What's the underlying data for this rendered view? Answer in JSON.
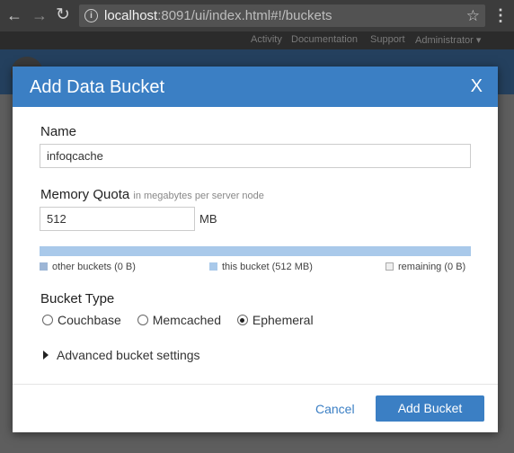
{
  "browser": {
    "url_host": "localhost",
    "url_rest": ":8091/ui/index.html#!/buckets"
  },
  "app_nav": {
    "links": [
      "Activity",
      "Documentation",
      "Support",
      "Administrator ▾"
    ]
  },
  "modal": {
    "title": "Add Data Bucket",
    "close_label": "X",
    "name_label": "Name",
    "name_value": "infoqcache",
    "memory_label": "Memory Quota",
    "memory_hint": "in megabytes per server node",
    "memory_value": "512",
    "memory_unit": "MB",
    "quota_bar": {
      "legend": [
        {
          "label": "other buckets (0 B)",
          "color": "#9db6d6"
        },
        {
          "label": "this bucket (512 MB)",
          "color": "#a9c9ea"
        },
        {
          "label": "remaining (0 B)",
          "color": "#efefef"
        }
      ]
    },
    "bucket_type_label": "Bucket Type",
    "bucket_types": [
      {
        "label": "Couchbase",
        "checked": false
      },
      {
        "label": "Memcached",
        "checked": false
      },
      {
        "label": "Ephemeral",
        "checked": true
      }
    ],
    "advanced_label": "Advanced bucket settings",
    "cancel_label": "Cancel",
    "submit_label": "Add Bucket"
  },
  "colors": {
    "accent": "#3b7fc4"
  }
}
